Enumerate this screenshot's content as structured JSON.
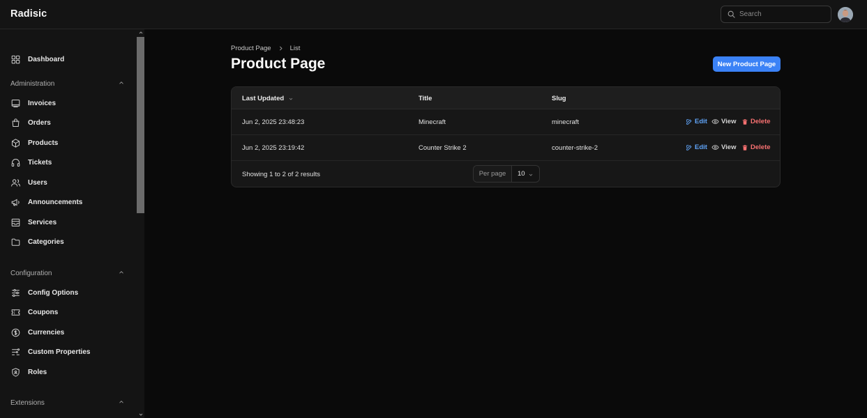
{
  "app": {
    "brand": "Radisic"
  },
  "search": {
    "placeholder": "Search"
  },
  "sidebar": {
    "items_top": [
      {
        "label": "Dashboard",
        "icon": "dashboard-icon"
      }
    ],
    "groups": [
      {
        "label": "Administration",
        "items": [
          {
            "label": "Invoices",
            "icon": "invoice-icon"
          },
          {
            "label": "Orders",
            "icon": "shopping-bag-icon"
          },
          {
            "label": "Products",
            "icon": "cube-icon"
          },
          {
            "label": "Tickets",
            "icon": "headphones-icon"
          },
          {
            "label": "Users",
            "icon": "users-icon"
          },
          {
            "label": "Announcements",
            "icon": "megaphone-icon"
          },
          {
            "label": "Services",
            "icon": "archive-box-icon"
          },
          {
            "label": "Categories",
            "icon": "folder-icon"
          }
        ]
      },
      {
        "label": "Configuration",
        "items": [
          {
            "label": "Config Options",
            "icon": "sliders-icon"
          },
          {
            "label": "Coupons",
            "icon": "ticket-icon"
          },
          {
            "label": "Currencies",
            "icon": "dollar-circle-icon"
          },
          {
            "label": "Custom Properties",
            "icon": "adjustments-icon"
          },
          {
            "label": "Roles",
            "icon": "shield-icon"
          }
        ]
      },
      {
        "label": "Extensions",
        "items": []
      }
    ]
  },
  "breadcrumb": {
    "parent": "Product Page",
    "current": "List"
  },
  "page": {
    "title": "Product Page",
    "new_button": "New Product Page"
  },
  "table": {
    "columns": {
      "updated": "Last Updated",
      "title": "Title",
      "slug": "Slug"
    },
    "rows": [
      {
        "updated": "Jun 2, 2025 23:48:23",
        "title": "Minecraft",
        "slug": "minecraft"
      },
      {
        "updated": "Jun 2, 2025 23:19:42",
        "title": "Counter Strike 2",
        "slug": "counter-strike-2"
      }
    ],
    "actions": {
      "edit": "Edit",
      "view": "View",
      "delete": "Delete"
    },
    "footer": {
      "summary": "Showing 1 to 2 of 2 results",
      "per_page_label": "Per page",
      "per_page_value": "10"
    }
  },
  "colors": {
    "accent": "#3b82f6",
    "danger": "#f87171",
    "link": "#60a5fa",
    "background": "#0a0a0a"
  }
}
